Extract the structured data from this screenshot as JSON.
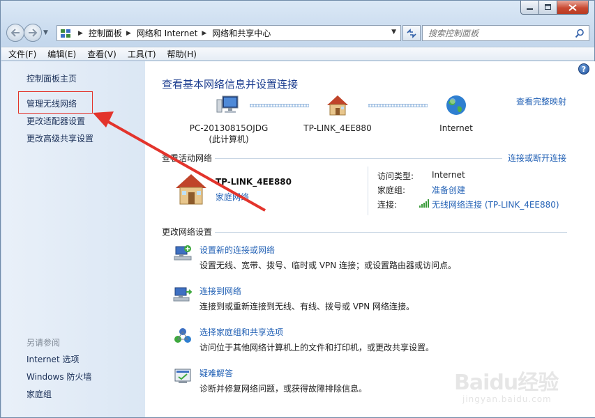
{
  "window": {
    "buttons": {
      "minimize": "minimize",
      "maximize": "maximize",
      "close": "close"
    }
  },
  "address": {
    "crumbs": [
      "控制面板",
      "网络和 Internet",
      "网络和共享中心"
    ]
  },
  "search": {
    "placeholder": "搜索控制面板"
  },
  "menu": [
    "文件(F)",
    "编辑(E)",
    "查看(V)",
    "工具(T)",
    "帮助(H)"
  ],
  "sidebar": {
    "items": [
      "控制面板主页",
      "管理无线网络",
      "更改适配器设置",
      "更改高级共享设置"
    ],
    "see_also_title": "另请参阅",
    "see_also": [
      "Internet 选项",
      "Windows 防火墙",
      "家庭组"
    ]
  },
  "main": {
    "title": "查看基本网络信息并设置连接",
    "full_map": "查看完整映射",
    "nodes": {
      "computer": {
        "name": "PC-20130815OJDG",
        "sub": "(此计算机)"
      },
      "router": {
        "name": "TP-LINK_4EE880"
      },
      "internet": {
        "name": "Internet"
      }
    },
    "active": {
      "heading": "查看活动网络",
      "connect_link": "连接或断开连接",
      "network_name": "TP-LINK_4EE880",
      "network_type": "家庭网络",
      "access_label": "访问类型:",
      "access_value": "Internet",
      "homegroup_label": "家庭组:",
      "homegroup_value": "准备创建",
      "connection_label": "连接:",
      "connection_value": "无线网络连接 (TP-LINK_4EE880)"
    },
    "change": {
      "heading": "更改网络设置",
      "tasks": [
        {
          "title": "设置新的连接或网络",
          "desc": "设置无线、宽带、拨号、临时或 VPN 连接；或设置路由器或访问点。"
        },
        {
          "title": "连接到网络",
          "desc": "连接到或重新连接到无线、有线、拨号或 VPN 网络连接。"
        },
        {
          "title": "选择家庭组和共享选项",
          "desc": "访问位于其他网络计算机上的文件和打印机，或更改共享设置。"
        },
        {
          "title": "疑难解答",
          "desc": "诊断并修复网络问题，或获得故障排除信息。"
        }
      ]
    }
  },
  "watermark": {
    "brand": "Baidu经验",
    "url": "jingyan.baidu.com"
  },
  "colors": {
    "link": "#2563b6",
    "title": "#1c3d8f",
    "annotation": "#e3342c"
  }
}
